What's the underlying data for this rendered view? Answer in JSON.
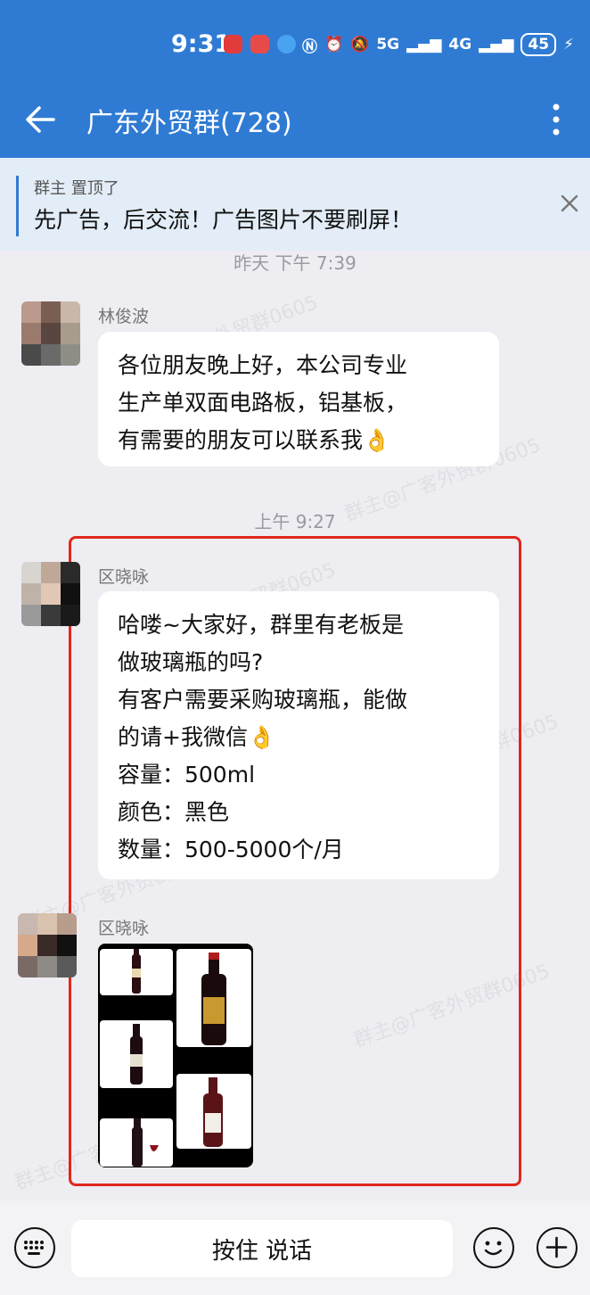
{
  "status_bar": {
    "time": "9:31",
    "network_5g": "5G",
    "network_4g": "4G",
    "battery": "45"
  },
  "header": {
    "title": "广东外贸群(728)"
  },
  "pinned": {
    "meta": "群主 置顶了",
    "text": "先广告，后交流！广告图片不要刷屏！"
  },
  "timestamps": {
    "t1": "昨天 下午 7:39",
    "t2": "上午 9:27"
  },
  "messages": [
    {
      "sender": "林俊波",
      "text": "各位朋友晚上好，本公司专业\n生产单双面电路板，铝基板，\n有需要的朋友可以联系我👌"
    },
    {
      "sender": "区晓咏",
      "text": "哈喽~大家好，群里有老板是\n做玻璃瓶的吗?\n有客户需要采购玻璃瓶，能做\n的请+我微信👌\n容量：500ml\n颜色：黑色\n数量：500-5000个/月"
    },
    {
      "sender": "区晓咏",
      "type": "image"
    }
  ],
  "watermark": "群主@广客外贸群0605",
  "input": {
    "talk_label": "按住 说话"
  },
  "colors": {
    "header_bg": "#2f7bd4",
    "pin_bg": "#e3edf7",
    "highlight": "#e0271c",
    "chat_bg": "#ededf2"
  },
  "icons": [
    "back-arrow-icon",
    "more-vertical-icon",
    "close-icon",
    "keyboard-icon",
    "emoji-icon",
    "plus-icon"
  ]
}
